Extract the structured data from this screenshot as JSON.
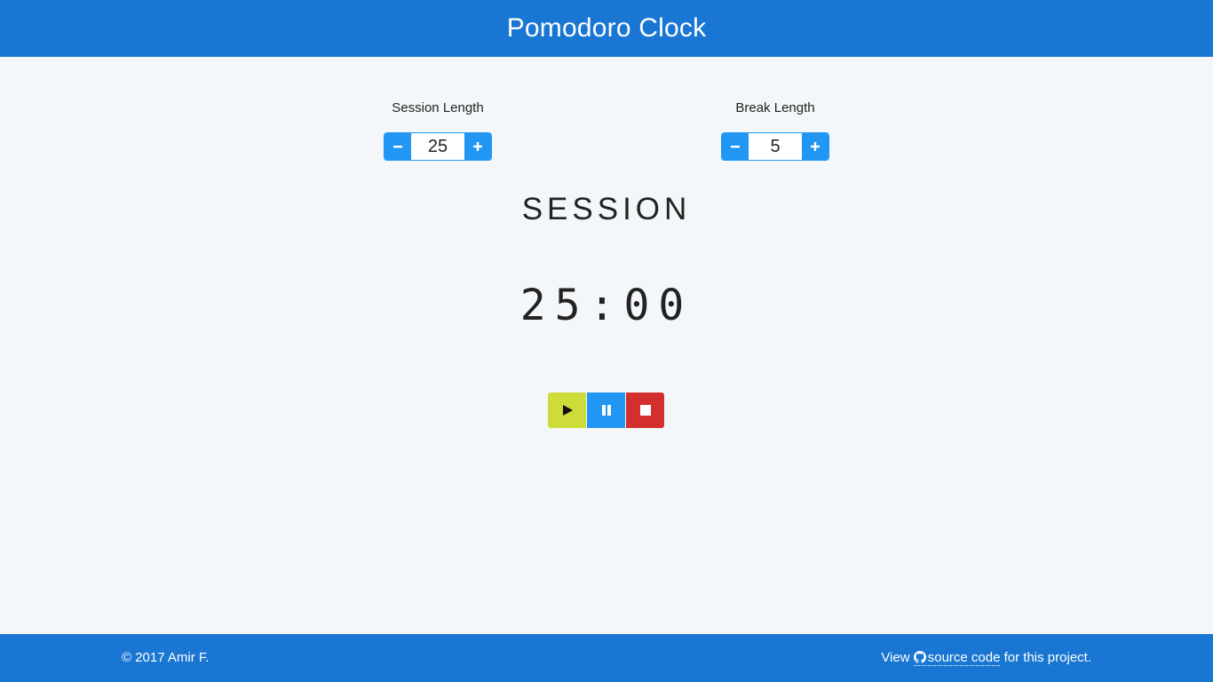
{
  "header": {
    "title": "Pomodoro Clock"
  },
  "settings": {
    "session": {
      "label": "Session Length",
      "value": "25"
    },
    "break": {
      "label": "Break Length",
      "value": "5"
    }
  },
  "mode": {
    "label": "SESSION"
  },
  "timer": {
    "display": "25:00"
  },
  "controls": {
    "play_icon": "play-icon",
    "pause_icon": "pause-icon",
    "stop_icon": "stop-icon"
  },
  "footer": {
    "copyright": "© 2017 Amir F.",
    "view_prefix": "View ",
    "link_text": "source code",
    "view_suffix": " for this project.",
    "link_icon": "github-icon"
  },
  "colors": {
    "header_bg": "#1976d2",
    "button_blue": "#2196f3",
    "play": "#cddc39",
    "stop": "#d32f2f",
    "page_bg": "#f4f7f9"
  }
}
